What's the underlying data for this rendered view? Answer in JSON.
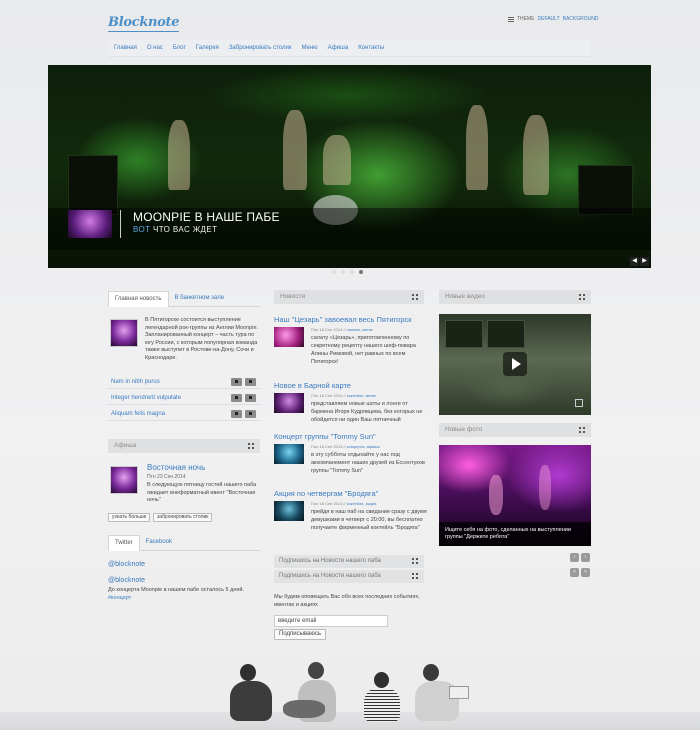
{
  "header": {
    "logo": "Blocknote",
    "theme_label": "THEME",
    "theme_default": "DEFAULT",
    "theme_background": "BACKGROUND"
  },
  "nav": {
    "items": [
      "Главная",
      "О нас",
      "Блог",
      "Галерея",
      "Забронировать столик",
      "Меню",
      "Афиша",
      "Контакты"
    ]
  },
  "slider": {
    "title": "MOONPIE В НАШЕ ПАБЕ",
    "subtitle_highlight": "ВОТ",
    "subtitle_rest": "ЧТО ВАС ЖДЕТ",
    "prev": "◀",
    "next": "▶"
  },
  "left": {
    "tabs": [
      "Главная новость",
      "В банкетном зале"
    ],
    "main_news_text": "В Пятигорске состоится выступление легендарной рок-группы из Англии Moonpie. Запланированный концерт – часть тура по югу России, с которым популярная команда также выступит в Ростове-на-Дону, Сочи и Краснодаре.",
    "links": [
      "Nam in nibh purus",
      "Integer hendrerit vulputate",
      "Aliquam felis magna"
    ],
    "afisha_title": "Афиша",
    "event_title": "Восточная ночь",
    "event_date": "Птн 23 Сен 2014",
    "event_text": "В следующую пятницу гостей нашего паба ожидает внеформатный ивент \"Восточная ночь\"",
    "btn_more": "узнать больше",
    "btn_book": "забронировать столик",
    "social_tabs": [
      "Twitter",
      "Facebook"
    ],
    "twitter_handle_1": "@blocknote",
    "twitter_handle_2": "@blocknote",
    "tweet_text": "До концерта Moonpie в нашем пабе осталось 5 дней.",
    "tweet_tag": "#концерт"
  },
  "middle": {
    "news_title": "Новости",
    "posts": [
      {
        "title": "Наш \"Цезарь\" завоевал весь Пятигорск",
        "meta": "Пон 18 Сен 2014 //",
        "tags": "салаты, меню",
        "text": "салату «Цезарь», приготовленному по секретному рецепту нашего шеф-повара Алины Римовой, нет равных по всем Пятигорск!"
      },
      {
        "title": "Новое в Барной карте",
        "meta": "Пон 18 Сен 2014 //",
        "tags": "коктейли, меню",
        "text": "представляем новые шоты и лонги от бармена Игоря Кудрявцева, без которых не обойдется ни один Ваш пятничный"
      },
      {
        "title": "Концерт группы \"Tommy Sun\"",
        "meta": "Пон 18 Сен 2014 //",
        "tags": "концерты, афиша",
        "text": "в эту субботы отдыхайте у нас под аккомпанемент наших друзей из Ессентуков группы \"Tommy Sun\""
      },
      {
        "title": "Акция по четвергам \"Бродяга\"",
        "meta": "Пон 18 Сен 2014 //",
        "tags": "коктейли, акции",
        "text": "прейдя в наш паб на свидание сразу с двумя девушками в четверг с 20:00, вы бесплатно получаете фирменный коктейль \"Бродяга\""
      }
    ],
    "subscribe_head_1": "Подпишись на Новости нашего паба",
    "subscribe_head_2": "Подпишись на Новости нашего паба",
    "subscribe_text": "Мы будем оповещать Вас обо всех последних событиях, ивентах и акциях",
    "email_placeholder": "введите email",
    "subscribe_btn": "Подписываюсь"
  },
  "right": {
    "video_title": "Новые видео",
    "photo_title": "Новые фото",
    "photo_caption": "Ищите себя на фото, сделанных на выступлении группы \"Держите ребята\""
  },
  "icons": {
    "prev": "‹",
    "next": "›",
    "up": "˄",
    "down": "˅"
  }
}
